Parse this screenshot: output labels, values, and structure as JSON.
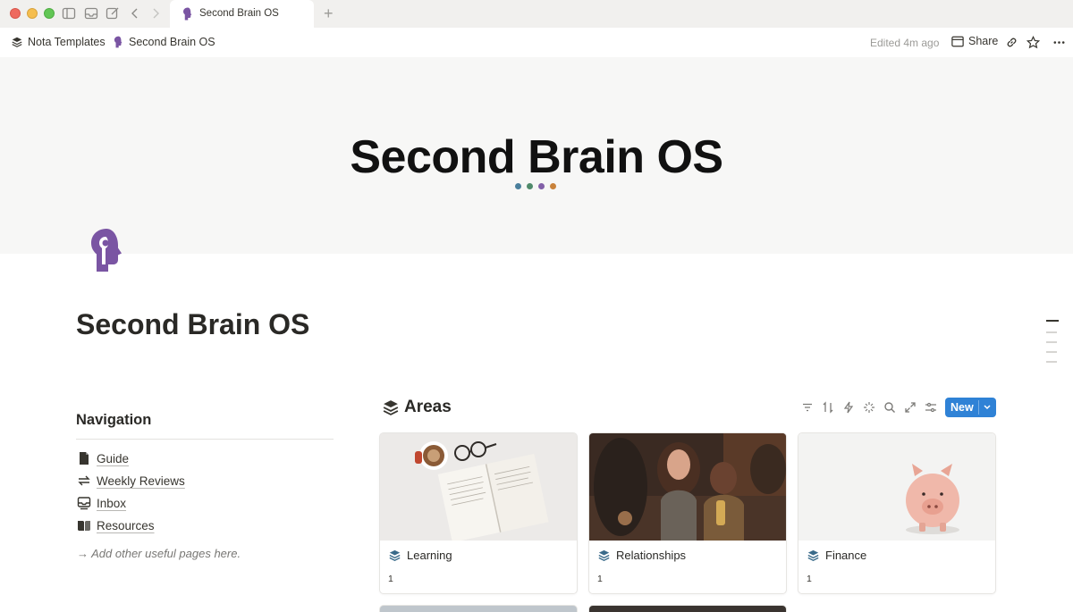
{
  "browser": {
    "tab_title": "Second Brain OS"
  },
  "breadcrumb": {
    "workspace": "Nota Templates",
    "page": "Second Brain OS"
  },
  "topbar": {
    "edited": "Edited 4m ago",
    "share_label": "Share"
  },
  "cover": {
    "title": "Second Brain OS",
    "dot_colors": [
      "#4a7f9c",
      "#4f8a6a",
      "#8260a8",
      "#c9823a"
    ]
  },
  "page": {
    "title": "Second Brain OS",
    "icon": "head-silhouette-icon",
    "accent_color": "#7a55a3"
  },
  "navigation": {
    "heading": "Navigation",
    "items": [
      {
        "label": "Guide",
        "icon": "document-icon"
      },
      {
        "label": "Weekly Reviews",
        "icon": "repeat-icon"
      },
      {
        "label": "Inbox",
        "icon": "inbox-icon"
      },
      {
        "label": "Resources",
        "icon": "books-icon"
      }
    ],
    "note": "→ Add other useful pages here."
  },
  "areas": {
    "title": "Areas",
    "new_label": "New",
    "new_color": "#2f82d6",
    "toolbar_icons": [
      "filter-icon",
      "sort-icon",
      "lightning-icon",
      "sparkle-icon",
      "search-icon",
      "expand-icon",
      "settings-icon"
    ],
    "cards": [
      {
        "name": "Learning",
        "count": "1",
        "image": "coffee-book-glasses-photo"
      },
      {
        "name": "Relationships",
        "count": "1",
        "image": "friends-laughing-photo"
      },
      {
        "name": "Finance",
        "count": "1",
        "image": "piggy-bank-photo"
      }
    ]
  }
}
